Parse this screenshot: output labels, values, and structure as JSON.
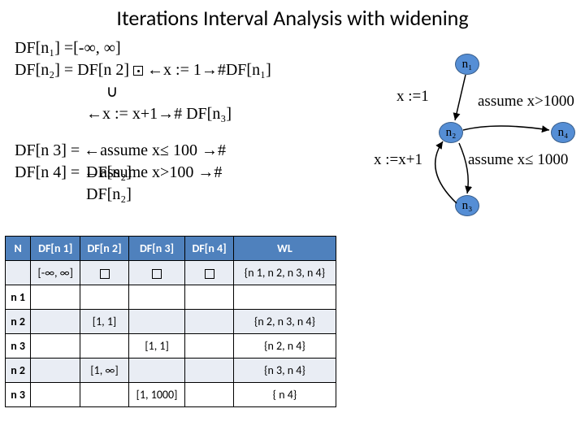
{
  "title": "Iterations Interval Analysis  with widening",
  "eq": {
    "l1": "DF[n₁] =[-∞, ∞]",
    "l2a": "DF[n₂] = DF[n 2] ",
    "l2b": " ←x := 1→#DF[n₁]",
    "cup": "∪",
    "l3": "←x := x+1→# DF[n₃]",
    "l4": "DF[n 3] = ←assume x≤ 100 →#",
    "l5over": "DF[n 4] = ←assume x>100 →#",
    "l5under": "DF[n₂]",
    "l6under": "DF[n₂]"
  },
  "table": {
    "headers": [
      "N",
      "DF[n 1]",
      "DF[n 2]",
      "DF[n 3]",
      "DF[n 4]",
      "WL"
    ],
    "rows": [
      {
        "cls": "band",
        "cells": [
          "",
          "[-∞, ∞]",
          "□",
          "□",
          "□",
          "{n 1, n 2, n 3, n 4}"
        ]
      },
      {
        "cls": "plain",
        "cells": [
          "n 1",
          "",
          "",
          "",
          "",
          ""
        ]
      },
      {
        "cls": "band",
        "cells": [
          "n 2",
          "",
          "[1, 1]",
          "",
          "",
          "{n 2, n 3, n 4}"
        ]
      },
      {
        "cls": "plain",
        "cells": [
          "n 3",
          "",
          "",
          "[1, 1]",
          "",
          "{n 2, n 4}"
        ]
      },
      {
        "cls": "band",
        "cells": [
          "n 2",
          "",
          "[1, ∞]",
          "",
          "",
          "{n 3, n 4}"
        ]
      },
      {
        "cls": "plain",
        "cells": [
          "n 3",
          "",
          "",
          "[1, 1000]",
          "",
          "{ n 4}"
        ]
      }
    ]
  },
  "graph": {
    "n1": "n₁",
    "n2": "n₂",
    "n3": "n₃",
    "n4": "n₄",
    "xeq1": "x :=1",
    "ax1000": "assume x>1000",
    "xxp1": "x :=x+1",
    "axle1000": "assume x≤ 1000"
  }
}
